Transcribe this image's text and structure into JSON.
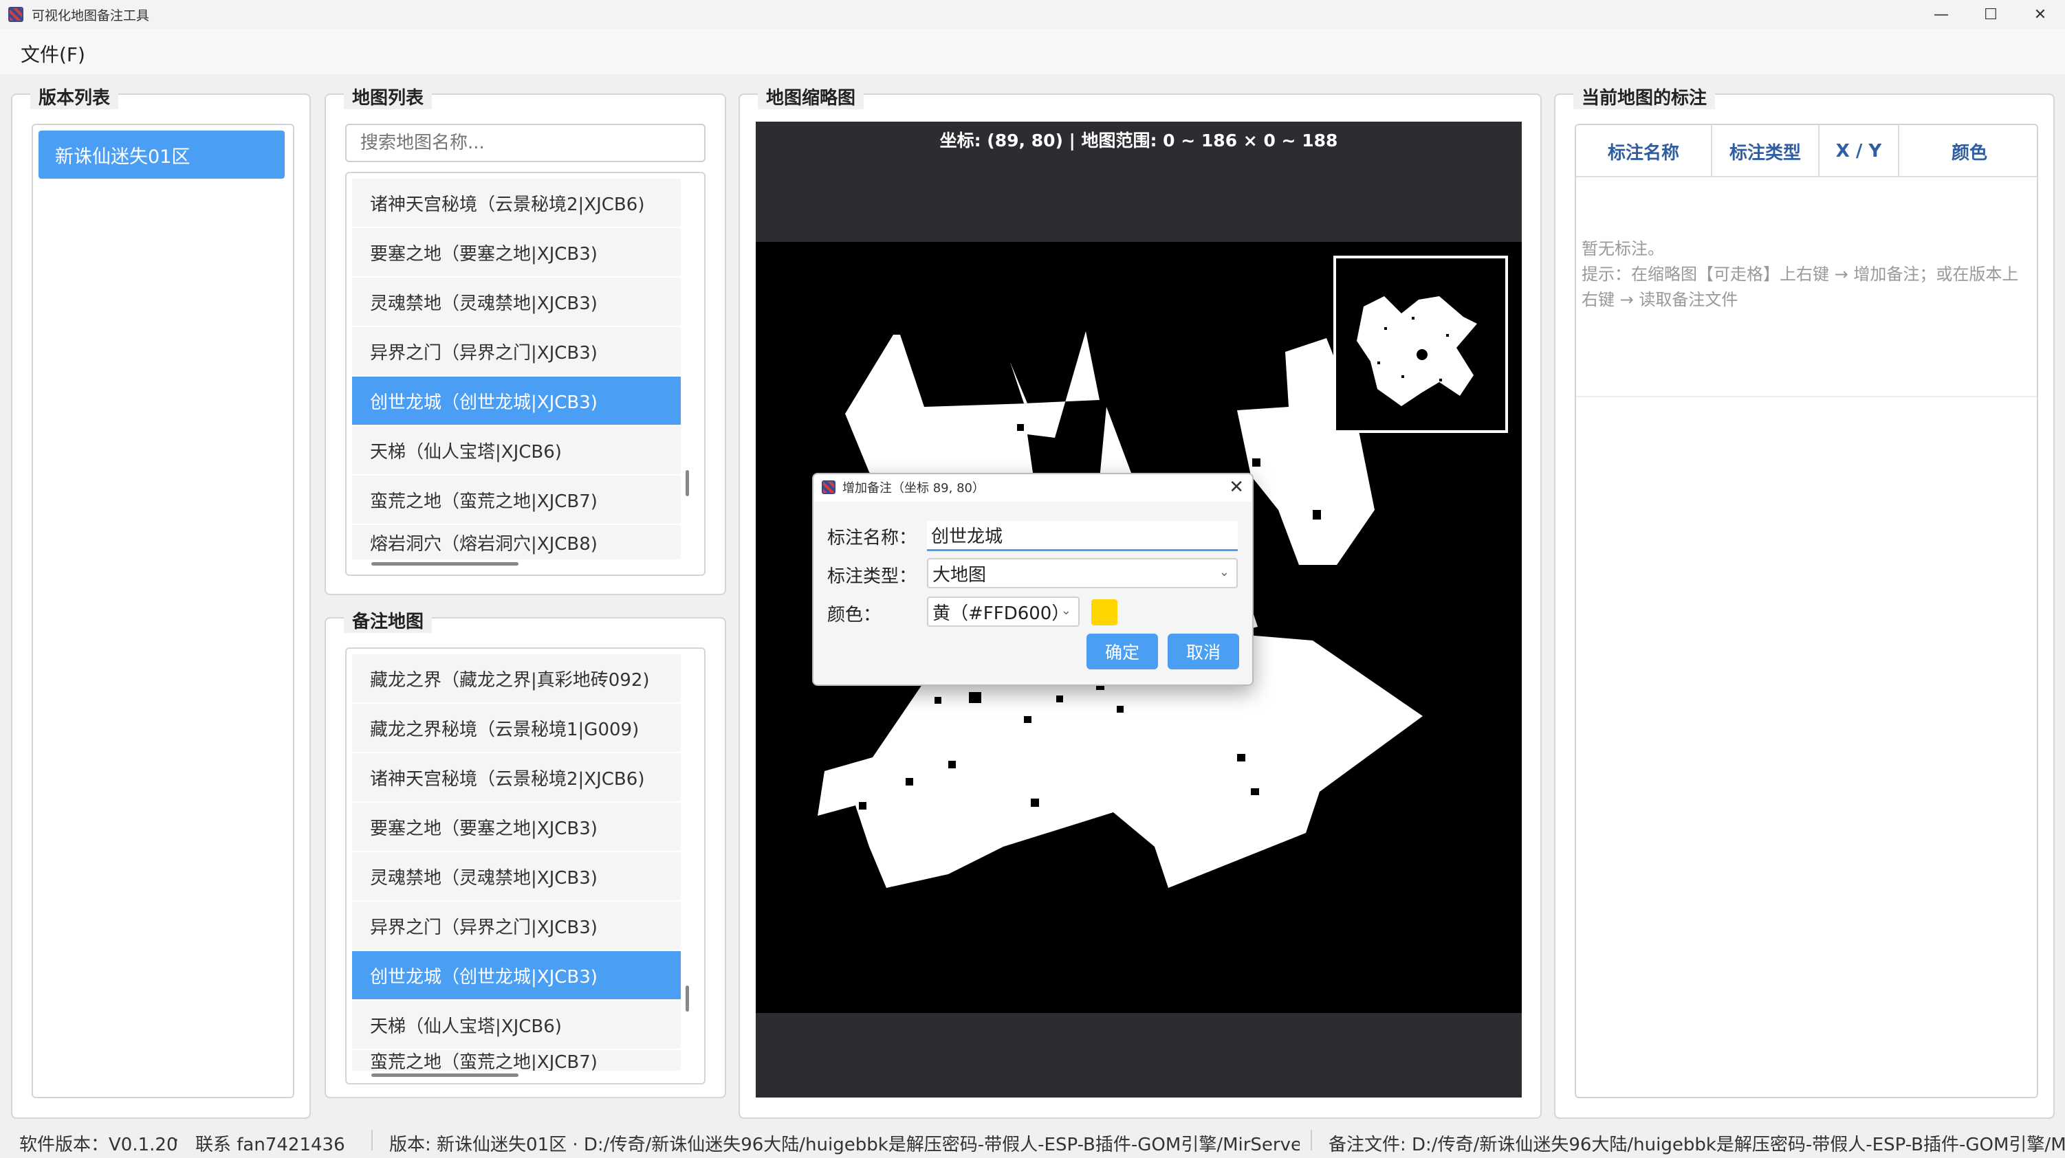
{
  "window": {
    "title": "可视化地图备注工具",
    "minimize_icon": "—",
    "maximize_icon": "☐",
    "close_icon": "✕"
  },
  "menu": {
    "file_label": "文件(F)"
  },
  "version_panel": {
    "title": "版本列表",
    "items": [
      "新诛仙迷失01区"
    ]
  },
  "map_list_panel": {
    "title": "地图列表",
    "search_placeholder": "搜索地图名称...",
    "items": [
      "诸神天宫秘境（云景秘境2|XJCB6)",
      "要塞之地（要塞之地|XJCB3)",
      "灵魂禁地（灵魂禁地|XJCB3)",
      "异界之门（异界之门|XJCB3)",
      "创世龙城（创世龙城|XJCB3)",
      "天梯（仙人宝塔|XJCB6)",
      "蛮荒之地（蛮荒之地|XJCB7)",
      "熔岩洞穴（熔岩洞穴|XJCB8)"
    ],
    "selected_index": 4
  },
  "note_map_panel": {
    "title": "备注地图",
    "items": [
      "藏龙之界（藏龙之界|真彩地砖092)",
      "藏龙之界秘境（云景秘境1|G009)",
      "诸神天宫秘境（云景秘境2|XJCB6)",
      "要塞之地（要塞之地|XJCB3)",
      "灵魂禁地（灵魂禁地|XJCB3)",
      "异界之门（异界之门|XJCB3)",
      "创世龙城（创世龙城|XJCB3)",
      "天梯（仙人宝塔|XJCB6)",
      "蛮荒之地（蛮荒之地|XJCB7)"
    ],
    "selected_index": 6
  },
  "thumbnail_panel": {
    "title": "地图缩略图",
    "coord_text": "坐标: (89, 80)  |  地图范围: 0 ~ 186 × 0 ~ 188"
  },
  "annotations_panel": {
    "title": "当前地图的标注",
    "columns": [
      "标注名称",
      "标注类型",
      "X / Y",
      "颜色"
    ],
    "empty_text": "暂无标注。",
    "hint_text": "提示：在缩略图【可走格】上右键 → 增加备注；或在版本上右键 → 读取备注文件"
  },
  "dialog": {
    "title": "增加备注（坐标 89, 80）",
    "close_icon": "✕",
    "name_label": "标注名称：",
    "name_value": "创世龙城",
    "type_label": "标注类型：",
    "type_value": "大地图",
    "color_label": "颜色：",
    "color_value": "黄（#FFD600）",
    "color_hex": "#FFD600",
    "ok_label": "确定",
    "cancel_label": "取消"
  },
  "statusbar": {
    "version_text": "软件版本：V0.1.20",
    "contact_text": "联系 fan7421436",
    "path_text": "版本: 新诛仙迷失01区 · D:/传奇/新诛仙迷失96大陆/huigebbk是解压密码-带假人-ESP-B插件-GOM引擎/MirServer",
    "note_file_text": "备注文件: D:/传奇/新诛仙迷失96大陆/huigebbk是解压密码-带假人-ESP-B插件-GOM引擎/MirServer"
  },
  "colors": {
    "accent": "#4a9ff5",
    "header_text": "#2f5fa0",
    "map_bg": "#2b2d31"
  }
}
